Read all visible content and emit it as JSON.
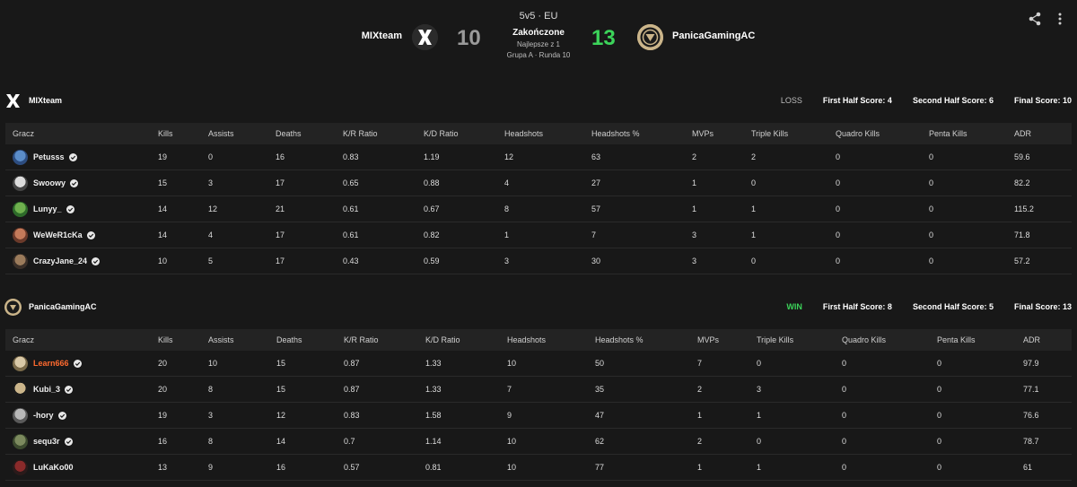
{
  "match": {
    "format": "5v5 · EU",
    "status": "Zakończone",
    "best_of": "Najlepsze z 1",
    "group_round": "Grupa A · Runda 10",
    "team1": "MIXteam",
    "team2": "PanicaGamingAC",
    "score1": "10",
    "score2": "13"
  },
  "toolbar": {
    "share_icon": "share-icon",
    "more_icon": "more-vertical-icon"
  },
  "colors": {
    "win": "#3cd45a",
    "loss_score": "#9a9a9a",
    "highlight_name": "#ff6a2f",
    "background": "#181818",
    "header_row": "#232323"
  },
  "columns": [
    "Gracz",
    "Kills",
    "Assists",
    "Deaths",
    "K/R Ratio",
    "K/D Ratio",
    "Headshots",
    "Headshots %",
    "MVPs",
    "Triple Kills",
    "Quadro Kills",
    "Penta Kills",
    "ADR"
  ],
  "teams": [
    {
      "name": "MIXteam",
      "result": "LOSS",
      "first_half": "First Half Score: 4",
      "second_half": "Second Half Score: 6",
      "final": "Final Score: 10",
      "players": [
        {
          "name": "Petusss",
          "stats": [
            "19",
            "0",
            "16",
            "0.83",
            "1.19",
            "12",
            "63",
            "2",
            "2",
            "0",
            "0",
            "59.6"
          ]
        },
        {
          "name": "Swoowy",
          "stats": [
            "15",
            "3",
            "17",
            "0.65",
            "0.88",
            "4",
            "27",
            "1",
            "0",
            "0",
            "0",
            "82.2"
          ]
        },
        {
          "name": "Lunyy_",
          "stats": [
            "14",
            "12",
            "21",
            "0.61",
            "0.67",
            "8",
            "57",
            "1",
            "1",
            "0",
            "0",
            "115.2"
          ]
        },
        {
          "name": "WeWeR1cKa",
          "stats": [
            "14",
            "4",
            "17",
            "0.61",
            "0.82",
            "1",
            "7",
            "3",
            "1",
            "0",
            "0",
            "71.8"
          ]
        },
        {
          "name": "CrazyJane_24",
          "stats": [
            "10",
            "5",
            "17",
            "0.43",
            "0.59",
            "3",
            "30",
            "3",
            "0",
            "0",
            "0",
            "57.2"
          ]
        }
      ]
    },
    {
      "name": "PanicaGamingAC",
      "result": "WIN",
      "first_half": "First Half Score: 8",
      "second_half": "Second Half Score: 5",
      "final": "Final Score: 13",
      "players": [
        {
          "name": "Learn666",
          "stats": [
            "20",
            "10",
            "15",
            "0.87",
            "1.33",
            "10",
            "50",
            "7",
            "0",
            "0",
            "0",
            "97.9"
          ]
        },
        {
          "name": "Kubi_3",
          "stats": [
            "20",
            "8",
            "15",
            "0.87",
            "1.33",
            "7",
            "35",
            "2",
            "3",
            "0",
            "0",
            "77.1"
          ]
        },
        {
          "name": "-hory",
          "stats": [
            "19",
            "3",
            "12",
            "0.83",
            "1.58",
            "9",
            "47",
            "1",
            "1",
            "0",
            "0",
            "76.6"
          ]
        },
        {
          "name": "sequ3r",
          "stats": [
            "16",
            "8",
            "14",
            "0.7",
            "1.14",
            "10",
            "62",
            "2",
            "0",
            "0",
            "0",
            "78.7"
          ]
        },
        {
          "name": "LuKaKo00",
          "stats": [
            "13",
            "9",
            "16",
            "0.57",
            "0.81",
            "10",
            "77",
            "1",
            "1",
            "0",
            "0",
            "61"
          ]
        }
      ]
    }
  ]
}
